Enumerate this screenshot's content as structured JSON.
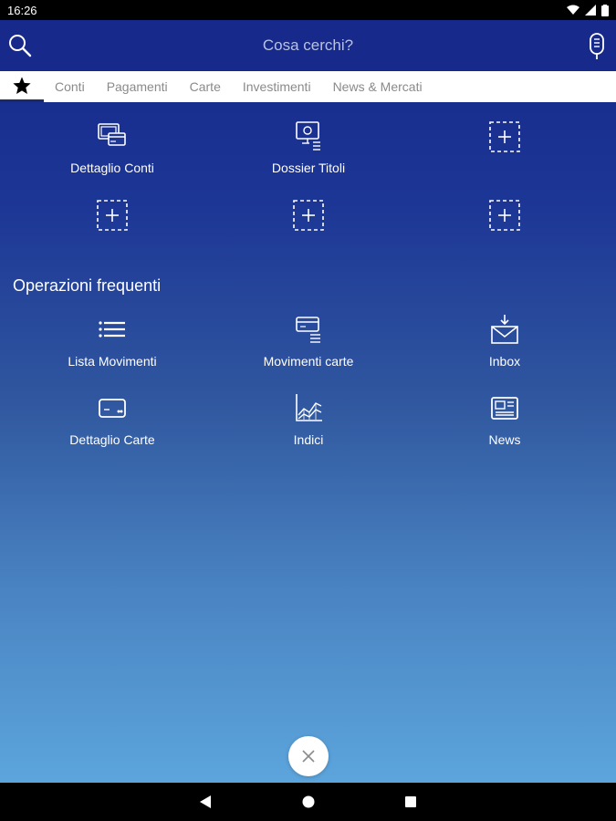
{
  "status": {
    "time": "16:26"
  },
  "search": {
    "placeholder": "Cosa cerchi?"
  },
  "tabs": [
    {
      "label": "Conti"
    },
    {
      "label": "Pagamenti"
    },
    {
      "label": "Carte"
    },
    {
      "label": "Investimenti"
    },
    {
      "label": "News & Mercati"
    }
  ],
  "favorites": [
    {
      "label": "Dettaglio Conti",
      "icon": "account-detail-icon"
    },
    {
      "label": "Dossier Titoli",
      "icon": "securities-dossier-icon"
    }
  ],
  "frequent": {
    "title": "Operazioni frequenti",
    "items": [
      {
        "label": "Lista Movimenti",
        "icon": "list-icon"
      },
      {
        "label": "Movimenti carte",
        "icon": "card-transactions-icon"
      },
      {
        "label": "Inbox",
        "icon": "inbox-icon"
      },
      {
        "label": "Dettaglio Carte",
        "icon": "card-icon"
      },
      {
        "label": "Indici",
        "icon": "chart-icon"
      },
      {
        "label": "News",
        "icon": "newspaper-icon"
      }
    ]
  },
  "colors": {
    "header": "#17298a",
    "gradient_top": "#15288a",
    "gradient_bottom": "#5ca5dc",
    "tab_indicator": "#1c2a6b"
  }
}
